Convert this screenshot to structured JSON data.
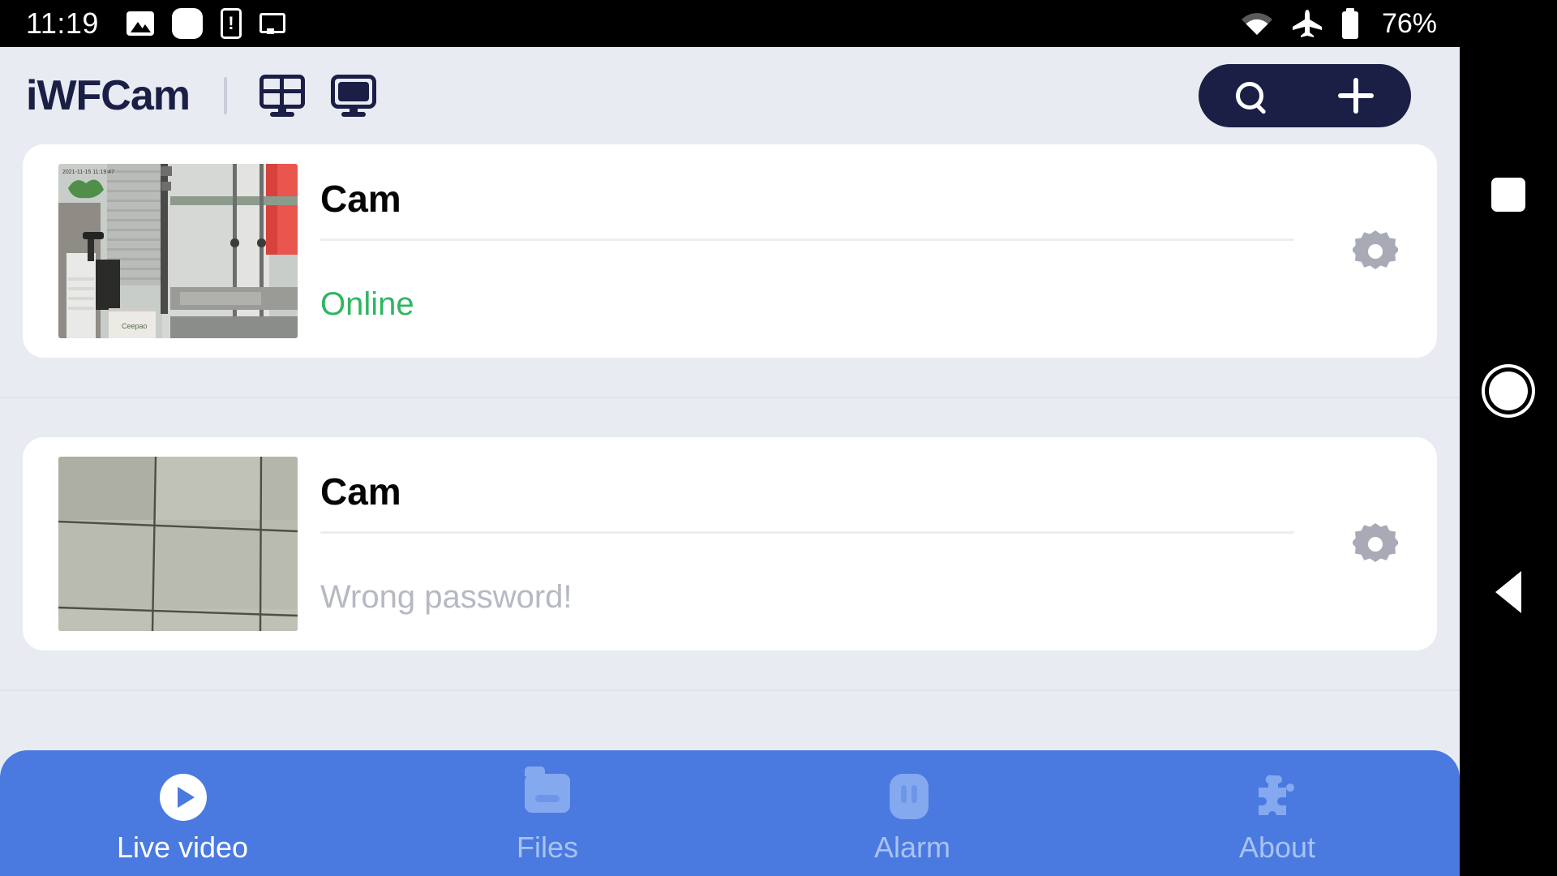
{
  "status_bar": {
    "clock": "11:19",
    "battery_percent": "76%",
    "left_icons": [
      "image-icon",
      "blob-icon",
      "phone-alert-icon",
      "cast-icon"
    ],
    "right_icons": [
      "wifi-icon",
      "airplane-mode-icon",
      "battery-icon"
    ]
  },
  "app_bar": {
    "logo": "iWFCam",
    "view_icons": [
      "grid-view-icon",
      "single-view-icon"
    ],
    "actions": [
      "search-icon",
      "add-icon"
    ]
  },
  "cameras": [
    {
      "name": "Cam",
      "status": "Online",
      "status_type": "online",
      "thumbnail": "office-interior-live-preview",
      "settings": "gear-icon"
    },
    {
      "name": "Cam",
      "status": "Wrong password!",
      "status_type": "error",
      "thumbnail": "tiled-wall-live-preview",
      "settings": "gear-icon"
    }
  ],
  "tabs": [
    {
      "label": "Live video",
      "icon": "play-circle-icon",
      "active": true
    },
    {
      "label": "Files",
      "icon": "folder-icon",
      "active": false
    },
    {
      "label": "Alarm",
      "icon": "alarm-pause-icon",
      "active": false
    },
    {
      "label": "About",
      "icon": "puzzle-piece-icon",
      "active": false
    }
  ],
  "nav_bar": {
    "recents": "recents-square-icon",
    "home": "home-circle-icon",
    "back": "back-triangle-icon"
  },
  "colors": {
    "brand_navy": "#1b1f45",
    "tab_blue": "#4a7ae0",
    "online_green": "#2fb661",
    "error_gray": "#b6b9c2",
    "background": "#e8ebf2"
  }
}
